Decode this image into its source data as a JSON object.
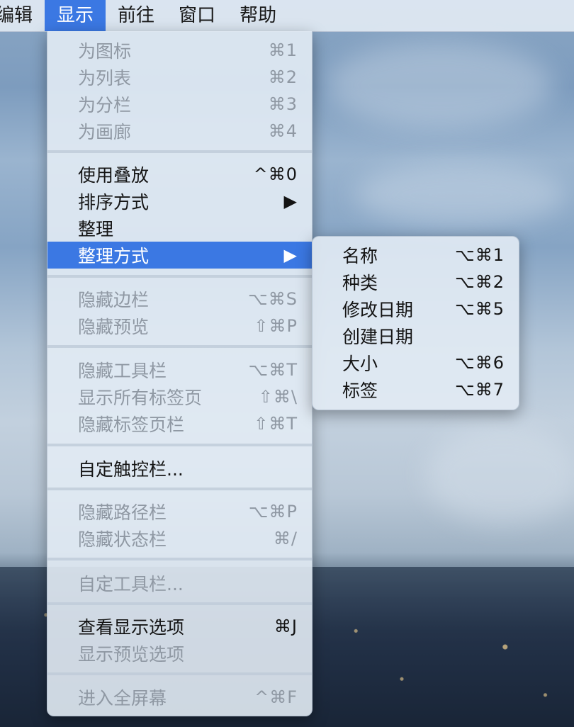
{
  "menubar": {
    "items": [
      "编辑",
      "显示",
      "前往",
      "窗口",
      "帮助"
    ],
    "active_index": 1
  },
  "view_menu": {
    "items": [
      {
        "label": "为图标",
        "shortcut": "⌘1",
        "enabled": false
      },
      {
        "label": "为列表",
        "shortcut": "⌘2",
        "enabled": false
      },
      {
        "label": "为分栏",
        "shortcut": "⌘3",
        "enabled": false
      },
      {
        "label": "为画廊",
        "shortcut": "⌘4",
        "enabled": false
      },
      {
        "label": "使用叠放",
        "shortcut": "^⌘0",
        "enabled": true
      },
      {
        "label": "排序方式",
        "shortcut": "▶",
        "enabled": true
      },
      {
        "label": "整理",
        "shortcut": "",
        "enabled": true
      },
      {
        "label": "整理方式",
        "shortcut": "▶",
        "enabled": true,
        "highlighted": true
      },
      {
        "label": "隐藏边栏",
        "shortcut": "⌥⌘S",
        "enabled": false
      },
      {
        "label": "隐藏预览",
        "shortcut": "⇧⌘P",
        "enabled": false
      },
      {
        "label": "隐藏工具栏",
        "shortcut": "⌥⌘T",
        "enabled": false
      },
      {
        "label": "显示所有标签页",
        "shortcut": "⇧⌘\\",
        "enabled": false
      },
      {
        "label": "隐藏标签页栏",
        "shortcut": "⇧⌘T",
        "enabled": false
      },
      {
        "label": "自定触控栏...",
        "shortcut": "",
        "enabled": true
      },
      {
        "label": "隐藏路径栏",
        "shortcut": "⌥⌘P",
        "enabled": false
      },
      {
        "label": "隐藏状态栏",
        "shortcut": "⌘/",
        "enabled": false
      },
      {
        "label": "自定工具栏...",
        "shortcut": "",
        "enabled": false
      },
      {
        "label": "查看显示选项",
        "shortcut": "⌘J",
        "enabled": true
      },
      {
        "label": "显示预览选项",
        "shortcut": "",
        "enabled": false
      },
      {
        "label": "进入全屏幕",
        "shortcut": "^⌘F",
        "enabled": false
      }
    ]
  },
  "arrange_submenu": {
    "items": [
      {
        "label": "名称",
        "shortcut": "⌥⌘1"
      },
      {
        "label": "种类",
        "shortcut": "⌥⌘2"
      },
      {
        "label": "修改日期",
        "shortcut": "⌥⌘5"
      },
      {
        "label": "创建日期",
        "shortcut": ""
      },
      {
        "label": "大小",
        "shortcut": "⌥⌘6"
      },
      {
        "label": "标签",
        "shortcut": "⌥⌘7"
      }
    ]
  },
  "colors": {
    "highlight": "#3b78e3",
    "disabled_text": "#8f98a3",
    "menu_background": "#e2ebf4"
  }
}
